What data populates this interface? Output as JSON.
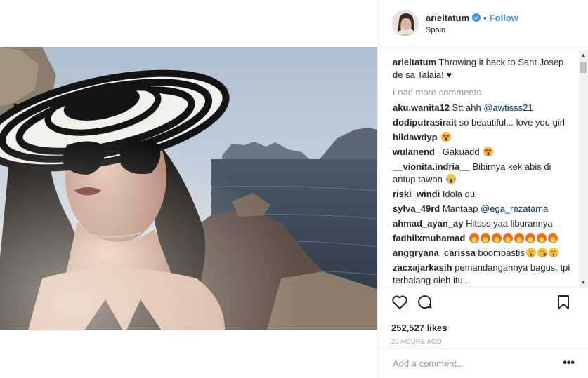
{
  "post": {
    "username": "arieltatum",
    "follow_separator": "•",
    "follow_label": "Follow",
    "location": "Spain",
    "caption_user": "arieltatum",
    "caption_text": " Throwing it back to Sant Josep de sa Talaia! ♥",
    "load_more": "Load more comments",
    "likes": "252,527 likes",
    "time": "20 HOURS AGO",
    "comment_placeholder": "Add a comment...",
    "more_options": "•••"
  },
  "comments": [
    {
      "user": "aku.wanita12",
      "text": " Stt ahh ",
      "mention": "@awtisss21"
    },
    {
      "user": "dodiputrasirait",
      "text": " so beautiful... love you girl"
    },
    {
      "user": "hildawdyp",
      "text": " ",
      "emoji": [
        "heart-eyes"
      ]
    },
    {
      "user": "wulanend_",
      "text": " Gakuadd ",
      "emoji": [
        "heart-eyes"
      ]
    },
    {
      "user": "__vionita.indria__",
      "text": " Bibirnya kek abis di antup tawon ",
      "emoji": [
        "laugh-tears"
      ]
    },
    {
      "user": "riski_windi",
      "text": " Idola qu"
    },
    {
      "user": "sylva_49rd",
      "text": " Mantaap ",
      "mention": "@ega_rezatama"
    },
    {
      "user": "ahmad_ayan_ay",
      "text": " Hitsss yaa liburannya"
    },
    {
      "user": "fadhilxmuhamad",
      "text": " ",
      "emoji": [
        "fire",
        "fire",
        "fire",
        "fire",
        "fire",
        "fire",
        "fire",
        "fire"
      ]
    },
    {
      "user": "anggryana_carissa",
      "text": " boombastis",
      "emoji": [
        "smirk",
        "kiss",
        "smirk"
      ]
    },
    {
      "user": "zacxajarkasih",
      "text": " pemandangannya bagus. tpi terhalang oleh itu..."
    }
  ],
  "icons": {
    "like": "heart-icon",
    "comment": "comment-bubble-icon",
    "save": "bookmark-icon",
    "verified": "verified-badge-icon"
  },
  "colors": {
    "follow": "#3897f0",
    "verified": "#3897f0",
    "muted": "#999999",
    "text": "#262626"
  }
}
